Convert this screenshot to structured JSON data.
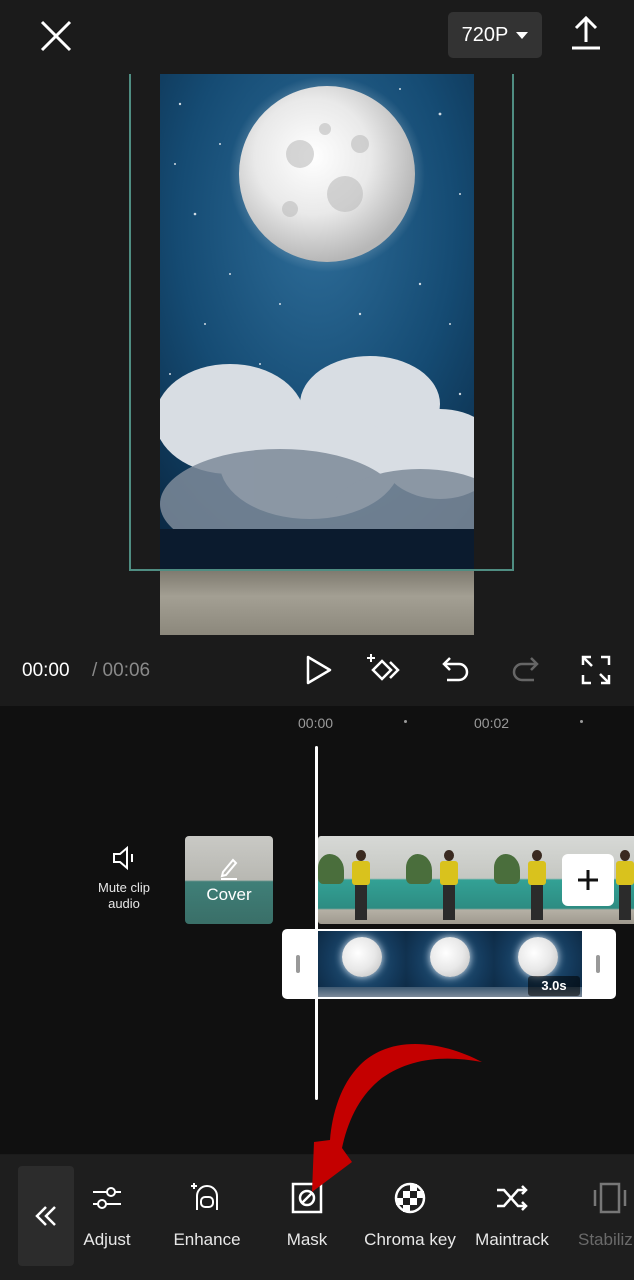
{
  "header": {
    "resolution": "720P"
  },
  "playback": {
    "current_time": "00:00",
    "total_time": "/ 00:06"
  },
  "timeline": {
    "ticks": [
      "00:00",
      "00:02"
    ],
    "mute_label_line1": "Mute clip",
    "mute_label_line2": "audio",
    "cover_label": "Cover",
    "overlay_duration": "3.0s"
  },
  "toolbar": {
    "items": [
      {
        "label": "Adjust",
        "icon": "sliders-icon"
      },
      {
        "label": "Enhance",
        "icon": "enhance-face-icon"
      },
      {
        "label": "Mask",
        "icon": "mask-icon"
      },
      {
        "label": "Chroma key",
        "icon": "chroma-key-icon"
      },
      {
        "label": "Maintrack",
        "icon": "shuffle-icon"
      },
      {
        "label": "Stabiliz",
        "icon": "stabilize-icon"
      }
    ]
  },
  "colors": {
    "background": "#1b1b1b",
    "timeline_bg": "#101010",
    "frame_border": "#4f8d82",
    "annotation_arrow": "#c40000"
  }
}
